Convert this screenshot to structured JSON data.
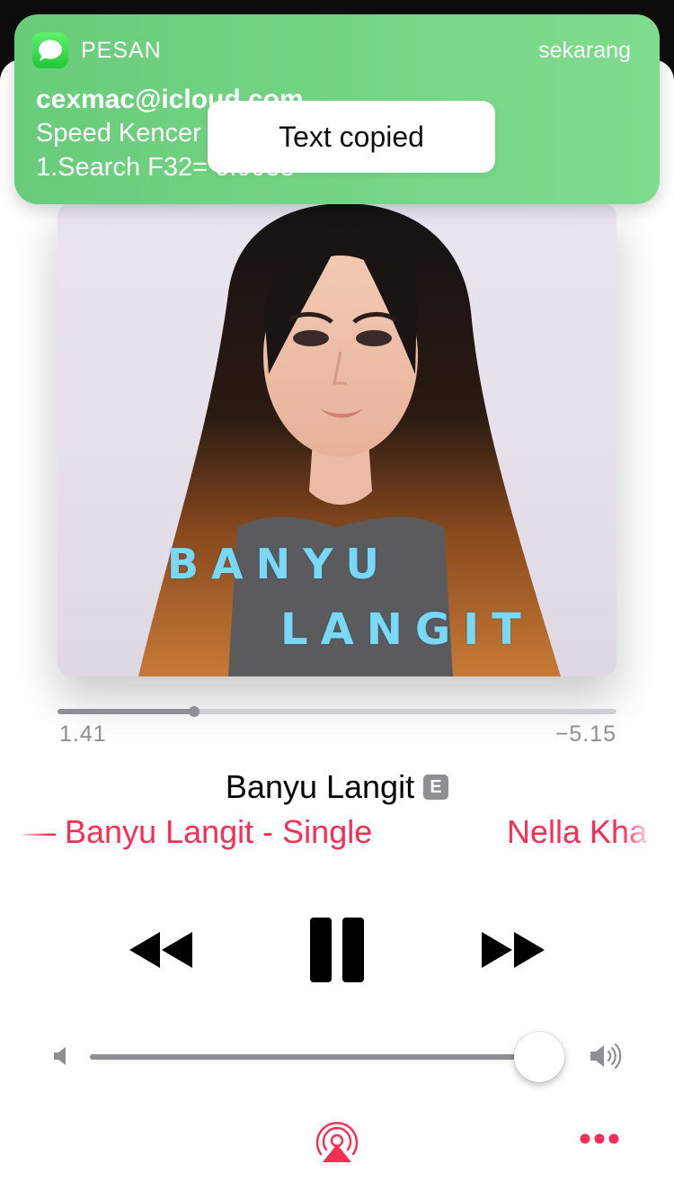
{
  "notification": {
    "app_name": "PESAN",
    "time": "sekarang",
    "sender": "cexmac@icloud.com",
    "line1": "Speed Kencer",
    "line2": "1.Search F32= 0.0058"
  },
  "toast": {
    "text": "Text copied"
  },
  "artwork": {
    "title_line1": "BANYU",
    "title_line2": "LANGIT"
  },
  "playback": {
    "elapsed": "1.41",
    "remaining": "−5.15",
    "progress_fraction": 0.245
  },
  "track": {
    "title": "Banyu Langit",
    "explicit_badge": "E",
    "subtitle_scroll_a": "ma — Banyu Langit - Single",
    "subtitle_scroll_b": "Nella Kha"
  },
  "volume": {
    "level_fraction": 1.0
  },
  "icons": {
    "rewind": "rewind-icon",
    "pause": "pause-icon",
    "fast_forward": "fast-forward-icon",
    "volume_low": "speaker-low-icon",
    "volume_high": "speaker-high-icon",
    "airplay": "airplay-icon",
    "more": "more-icon"
  },
  "colors": {
    "accent": "#fa2d55",
    "notification_bg": "#74d485",
    "control": "#000000",
    "slider_fill": "#8e8e93"
  }
}
